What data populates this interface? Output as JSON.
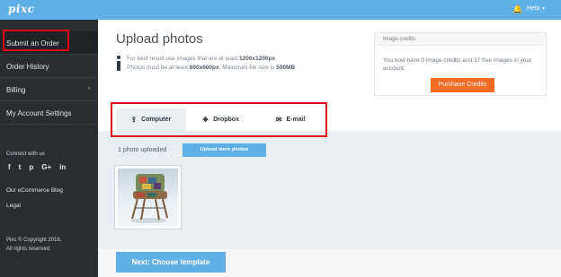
{
  "app": {
    "logo": "pixc"
  },
  "header": {
    "help_label": "Help",
    "help_caret": "▾",
    "bell_icon": "bell-icon"
  },
  "sidebar": {
    "items": [
      {
        "label": "Submit an Order",
        "active": true
      },
      {
        "label": "Order History"
      },
      {
        "label": "Billing",
        "caret": "›"
      },
      {
        "label": "My Account Settings"
      }
    ],
    "connect_label": "Connect with us",
    "social_icons": [
      {
        "name": "facebook-icon",
        "glyph": "f"
      },
      {
        "name": "twitter-icon",
        "glyph": "t"
      },
      {
        "name": "pinterest-icon",
        "glyph": "p"
      },
      {
        "name": "google-plus-icon",
        "glyph": "G+"
      },
      {
        "name": "linkedin-icon",
        "glyph": "in"
      }
    ],
    "blog_label": "Our eCommerce Blog",
    "legal_label": "Legal",
    "copyright_line1": "Pixc © Copyright 2016.",
    "copyright_line2": "All rights reserved."
  },
  "main": {
    "title": "Upload photos",
    "info_line1_prefix": "For best result use images that are at least ",
    "info_line1_bold": "1200x1200px",
    "info_line1_suffix": ".",
    "info_line2_prefix": "Photos must be at least ",
    "info_line2_bold": "600x600px",
    "info_line2_mid": ". Maximum file size is ",
    "info_line2_bold2": "500MB",
    "info_line2_suffix": ".",
    "credits": {
      "header": "Image credits",
      "text": "You now have 0 image credits and 37 free images in your account.",
      "button_label": "Purchase Credits"
    },
    "tabs": [
      {
        "label": "Computer",
        "icon": "upload-icon",
        "glyph": "⇪",
        "active": true
      },
      {
        "label": "Dropbox",
        "icon": "dropbox-icon",
        "glyph": "❖"
      },
      {
        "label": "E-mail",
        "icon": "envelope-icon",
        "glyph": "✉"
      }
    ],
    "uploaded_label": "1 photo uploaded",
    "upload_more_label": "Upload more photos",
    "next_button_label": "Next: Choose template"
  },
  "colors": {
    "accent_blue": "#5fb0e6",
    "sidebar_bg": "#2a2d32",
    "purchase_orange": "#f26b22",
    "highlight_red": "#e3001b"
  }
}
